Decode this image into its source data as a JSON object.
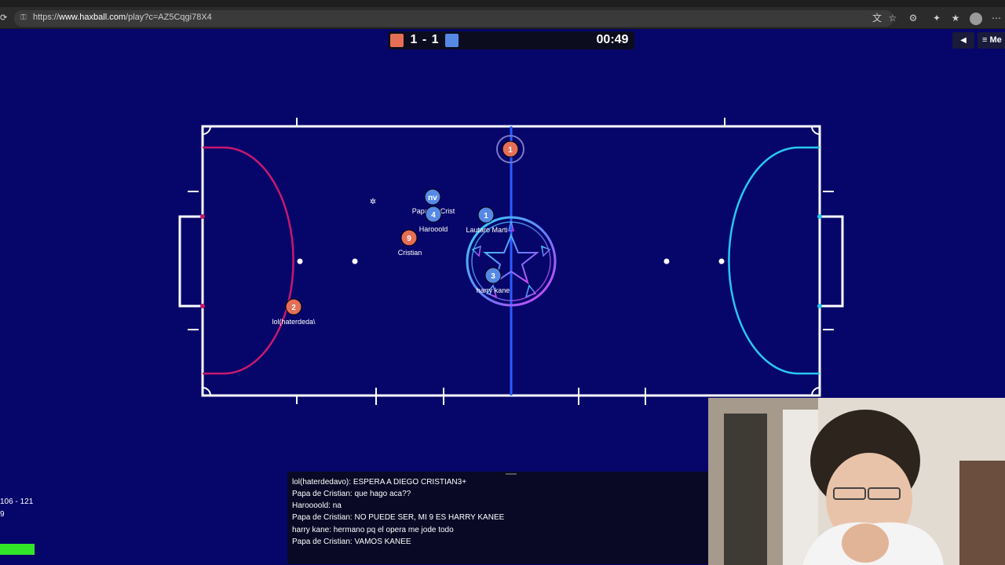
{
  "browser": {
    "url_prefix": "https://",
    "url_domain": "www.haxball.com",
    "url_path": "/play?c=AZ5Cqgi78X4",
    "icons": [
      "reload-icon",
      "lock-icon",
      "translate-icon",
      "star-icon",
      "extensions-icon",
      "puzzle-icon",
      "favorites-icon",
      "profile-icon",
      "more-icon"
    ]
  },
  "scoreboard": {
    "score": "1 - 1",
    "timer": "00:49",
    "red_color": "#e56e56",
    "blue_color": "#5689e5"
  },
  "controls": {
    "sound_icon": "◀",
    "menu_label": "≡ Me"
  },
  "players": [
    {
      "team": "red",
      "number": "1",
      "name": ""
    },
    {
      "team": "red",
      "number": "2",
      "name": "lol(haterdeda\\"
    },
    {
      "team": "red",
      "number": "9",
      "name": "Cristian"
    },
    {
      "team": "blue",
      "number": "nv",
      "name": "Papa de Crist"
    },
    {
      "team": "blue",
      "number": "4",
      "name": "Harooold"
    },
    {
      "team": "blue",
      "number": "1",
      "name": "Lautaro Marti"
    },
    {
      "team": "blue",
      "number": "3",
      "name": "harry kane"
    }
  ],
  "chat": [
    "lol(haterdedavo): ESPERA A DIEGO CRISTIAN3+",
    "Papa de Cristian: que hago aca??",
    "Haroooold: na",
    "Papa de Cristian: NO PUEDE SER, MI 9 ES HARRY KANEE",
    "harry kane: hermano pq el opera me jode todo",
    "Papa de Cristian: VAMOS KANEE"
  ],
  "stats": [
    "106 - 121",
    "9"
  ],
  "colors": {
    "background": "#06066a",
    "red_goal_arc": "#c8186e",
    "blue_goal_arc": "#28c8f0",
    "center_line": "#2a5cff",
    "ping_bar": "#32e628"
  }
}
